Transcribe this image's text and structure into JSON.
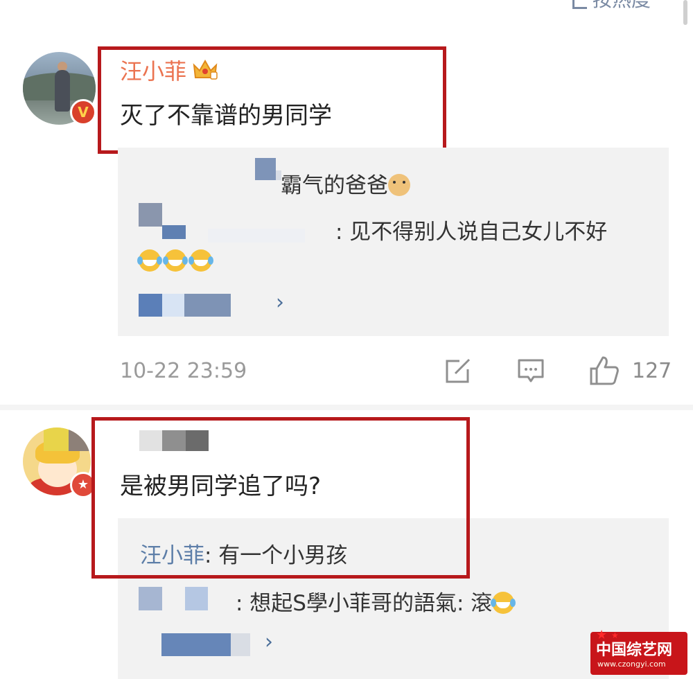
{
  "header": {
    "sort_label": "按热度"
  },
  "comment1": {
    "username": "汪小菲",
    "text": "灭了不靠谱的男同学",
    "replies": [
      {
        "text": "霸气的爸爸"
      },
      {
        "text": ": 见不得别人说自己女儿不好"
      }
    ],
    "timestamp": "10-22 23:59",
    "like_count": "127"
  },
  "comment2": {
    "text": "是被男同学追了吗?",
    "replies": [
      {
        "name": "汪小菲",
        "text": ": 有一个小男孩"
      },
      {
        "text": ": 想起S學小菲哥的語氣: 滾"
      }
    ]
  },
  "watermark": {
    "name": "中国综艺网",
    "url": "www.czongyi.com"
  },
  "colors": {
    "username": "#eb7350",
    "link_blue": "#5d7ea8",
    "highlight_red": "#b7191c"
  },
  "icons": [
    "crown-icon",
    "verified-icon",
    "share-icon",
    "comment-icon",
    "like-icon",
    "chevron-right-icon",
    "laugh-cry-emoji",
    "doge-emoji"
  ]
}
